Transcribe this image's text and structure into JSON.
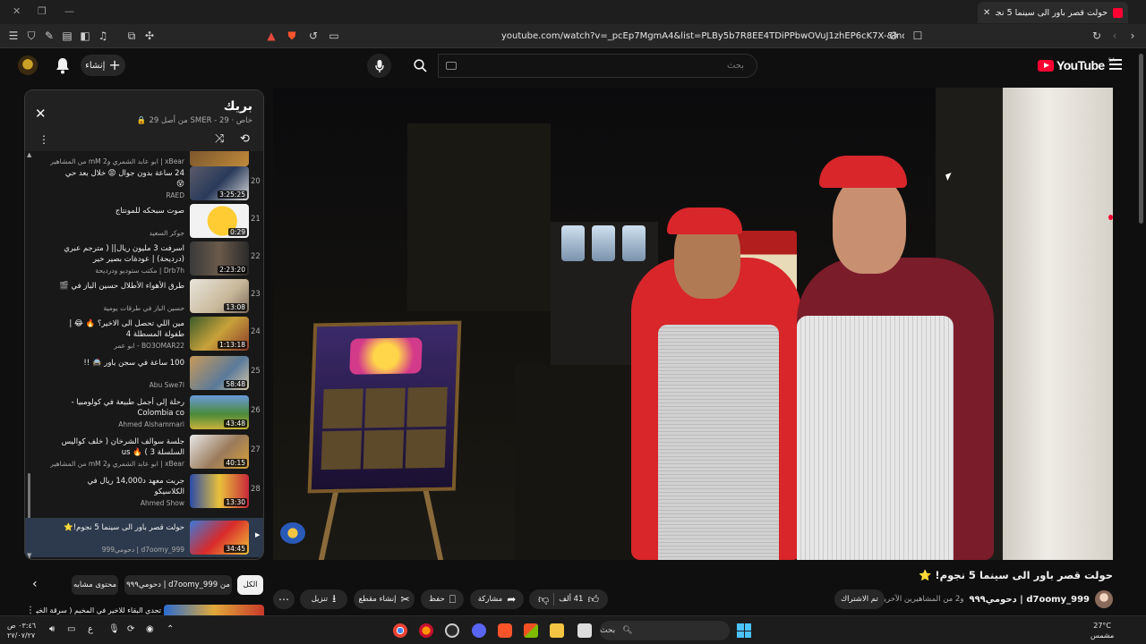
{
  "browser": {
    "tab_title": "حولت قصر باور الى سينما 5 نجو...",
    "url": "youtube.com/watch?v=_pcEp7MgmA4&list=PLBy5b7R8EE4TDiPPbwOVuJ1zhEP6cK7X-&index=29"
  },
  "header": {
    "create_label": "إنشاء",
    "search_placeholder": "بحث",
    "logo_text": "YouTube",
    "logo_region": "SA"
  },
  "playlist": {
    "title": "بريك",
    "subtitle": "خاص · SMER - 29 من أصل 29",
    "items": [
      {
        "num": "",
        "title": "",
        "channel": "xBear | ابو عابد الشمري وmM 2 من المشاهيرين",
        "duration": ""
      },
      {
        "num": "20",
        "title": "24 ساعة بدون جوال 😡 خلال بعد حي 😵",
        "channel": "RAED",
        "duration": "3:25:25"
      },
      {
        "num": "21",
        "title": "صوت سبحكه للمونتاج",
        "channel": "جوكر السعيد",
        "duration": "0:29"
      },
      {
        "num": "22",
        "title": "اسرفت 3 مليون ريال|| ( مترجم عبري (درديحة) | عودة‍ات بصير خير",
        "channel": "Drb7h | مكتب ستوديو ودرديحة",
        "duration": "2:23:20"
      },
      {
        "num": "23",
        "title": "طرق الأهواء الأطلال حسين الباز في 🎬",
        "channel": "حسين الباز في طرقات يومية",
        "duration": "13:08"
      },
      {
        "num": "24",
        "title": "مين اللي تحصل الى الاخير؟ 🔥 😂 | طفولة المسطلة 4",
        "channel": "BO3OMAR22 - ابو عمر",
        "duration": "1:13:18"
      },
      {
        "num": "25",
        "title": "100 ساعة في سجن باور 🚔 !!",
        "channel": "Abu Swe7l",
        "duration": "58:48"
      },
      {
        "num": "26",
        "title": "رحلة إلى أجمل طبيعة في كولومبيا - Colombia co",
        "channel": "Ahmed Alshammari",
        "duration": "43:48"
      },
      {
        "num": "27",
        "title": "جلسة سوالف الشرخان ( خلف كواليس السلسلة 3 ) 🔥 us",
        "channel": "xBear | ابو عابد الشمري وmM 2 من المشاهيرين",
        "duration": "40:15"
      },
      {
        "num": "28",
        "title": "جربت معهد د14,000 ريال في الكلاسيكو",
        "channel": "Ahmed Show",
        "duration": "13:30"
      },
      {
        "num": "",
        "title": "حولت قصر باور الى سينما 5 نجوم!⭐",
        "channel": "d7oomy_999 | دحومي999",
        "duration": "34:45"
      }
    ]
  },
  "video": {
    "title": "حولت قصر باور الى سينما 5 نجوم! ⭐",
    "channel": "d7oomy_999 | دحومي٩٩٩",
    "collab": "و2 من المشاهيرين الآخرين",
    "subscribed_label": "تم الاشتراك",
    "likes": "41 ألف",
    "share_label": "مشاركة",
    "save_label": "حفظ",
    "clip_label": "إنشاء مقطع",
    "download_label": "تنزيل"
  },
  "recommend": {
    "chip_all": "الكل",
    "chip_from": "من d7oomy_999 | دحومي٩٩٩",
    "chip_similar": "محتوى مشابه",
    "first_title": "تحدي البقاء للاخير في المخيم ( سرقة الخيمة )"
  },
  "taskbar": {
    "search_placeholder": "بحث",
    "time": "٠٣:٤٦ ص",
    "date": "٢٧/٠٧/٢٧",
    "lang": "ع",
    "temp": "27°C",
    "weather": "مشمس"
  },
  "colors": {
    "brand_red": "#ff0033",
    "background": "#0f0f0f",
    "panel": "#181818",
    "active_row": "#2d3a4d"
  }
}
